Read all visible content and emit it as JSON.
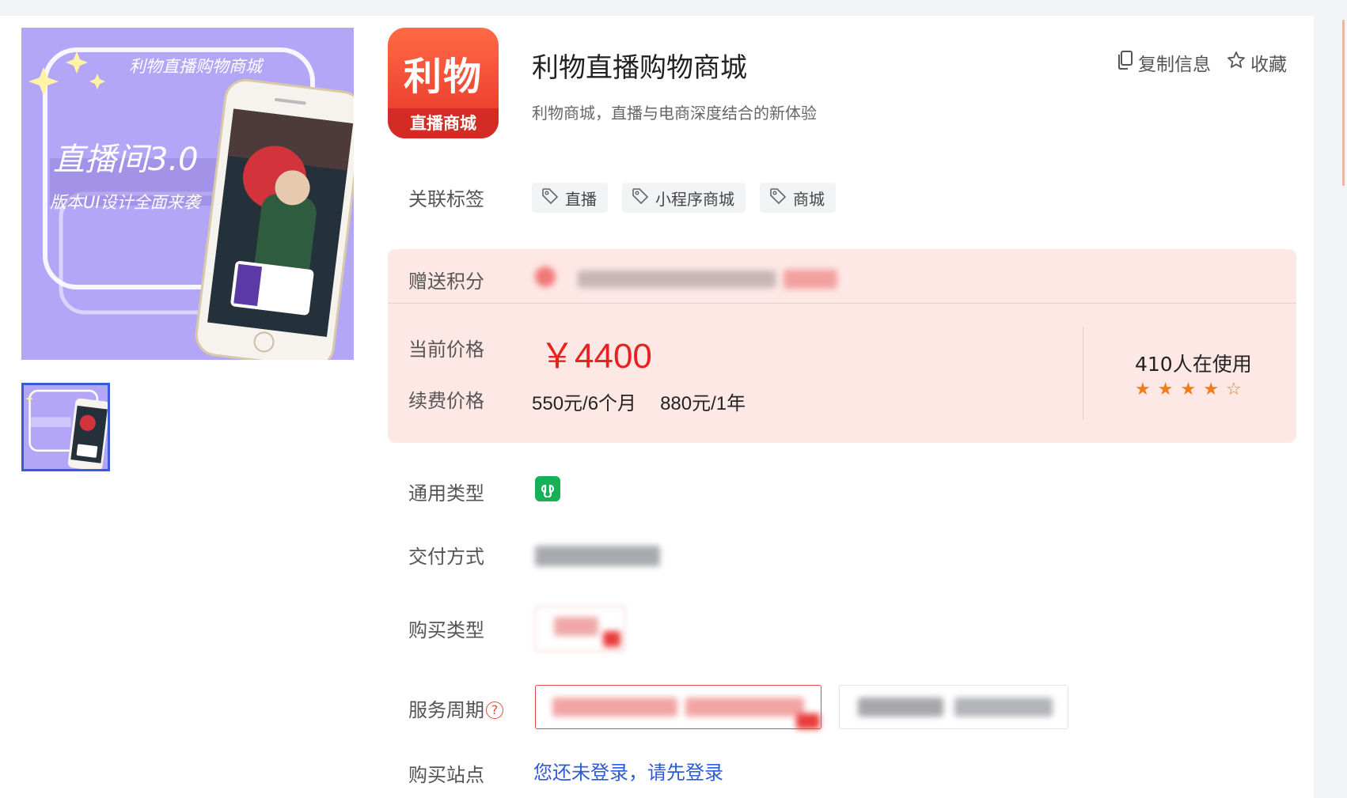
{
  "product": {
    "title": "利物直播购物商城",
    "subtitle": "利物商城，直播与电商深度结合的新体验",
    "logo_text": "利物",
    "logo_subtext": "直播商城"
  },
  "banner": {
    "caption_top": "利物直播购物商城",
    "headline": "直播间3.0",
    "tagline": "版本UI设计全面来袭"
  },
  "actions": {
    "copy_label": "复制信息",
    "favorite_label": "收藏"
  },
  "tags": {
    "label": "关联标签",
    "items": [
      "直播",
      "小程序商城",
      "商城"
    ]
  },
  "points": {
    "label": "赠送积分"
  },
  "price": {
    "current_label": "当前价格",
    "current_value": "￥4400",
    "renew_label": "续费价格",
    "renew_6m": "550元/6个月",
    "renew_1y": "880元/1年",
    "users": "410人在使用",
    "rating": 4,
    "rating_max": 5
  },
  "options": {
    "type_label": "通用类型",
    "delivery_label": "交付方式",
    "purchase_type_label": "购买类型",
    "period_label": "服务周期",
    "site_label": "购买站点",
    "login_prompt": "您还未登录，请先登录"
  },
  "icons": [
    "copy-icon",
    "star-outline-icon",
    "tag-icon",
    "miniapp-icon",
    "help-icon",
    "star-icon"
  ],
  "colors": {
    "accent_red": "#e8211f",
    "panel_bg": "#fde8e6",
    "star": "#f07c1a",
    "link": "#2d5bd8",
    "thumb_border": "#3a5bd9",
    "miniapp_green": "#16b056"
  }
}
